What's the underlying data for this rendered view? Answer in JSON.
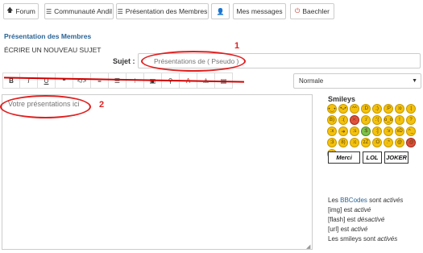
{
  "nav": {
    "items": [
      {
        "label": "Forum",
        "icon": "arrow-up-icon"
      },
      {
        "label": "Communauté Andil",
        "icon": "list-icon"
      },
      {
        "label": "Présentation des Membres",
        "icon": "list-icon"
      },
      {
        "label": "",
        "icon": "user-icon"
      },
      {
        "label": "Mes messages",
        "icon": ""
      },
      {
        "label": "Baechler",
        "icon": "power-icon"
      }
    ]
  },
  "page": {
    "section_title": "Présentation des Membres",
    "write_title": "ÉCRIRE UN NOUVEAU SUJET"
  },
  "form": {
    "subject_label": "Sujet :",
    "subject_placeholder": "Présentations de ( Pseudo )",
    "message_placeholder": "Votre présentations ici",
    "font_size_value": "Normale"
  },
  "toolbar": {
    "buttons": [
      {
        "label": "B",
        "icon": "bold-icon"
      },
      {
        "label": "I",
        "icon": "italic-icon"
      },
      {
        "label": "U",
        "icon": "underline-icon"
      },
      {
        "label": "❝",
        "icon": "quote-icon"
      },
      {
        "label": "</>",
        "icon": "code-icon"
      },
      {
        "label": "≡",
        "icon": "list-icon"
      },
      {
        "label": "☰",
        "icon": "list-ordered-icon"
      },
      {
        "label": "⁝",
        "icon": "list-item-icon"
      },
      {
        "label": "▣",
        "icon": "image-icon"
      },
      {
        "label": "⚲",
        "icon": "link-icon"
      },
      {
        "label": "A",
        "icon": "font-color-icon"
      },
      {
        "label": "⚠",
        "icon": "warning-icon"
      },
      {
        "label": "▤",
        "icon": "table-icon"
      }
    ]
  },
  "annotations": {
    "label_1": "1",
    "label_2": "2",
    "color": "#e02020"
  },
  "sidebar": {
    "smileys_title": "Smileys",
    "badges": [
      "Merci",
      "LOL",
      "JOKER"
    ],
    "bbcode_prefix": "Les ",
    "bbcode_link": "BBCodes",
    "bbcode_middle": " sont ",
    "bbcode_state": "activés",
    "img_tag": "[img]",
    "img_est": " est ",
    "img_state": "activé",
    "flash_tag": "[flash]",
    "flash_est": " est ",
    "flash_state": "désactivé",
    "url_tag": "[url]",
    "url_est": " est ",
    "url_state": "activé",
    "smileys_text": "Les smileys sont ",
    "smileys_state": "activés"
  },
  "colors": {
    "link": "#2a6496",
    "highlight": "#e02020"
  }
}
